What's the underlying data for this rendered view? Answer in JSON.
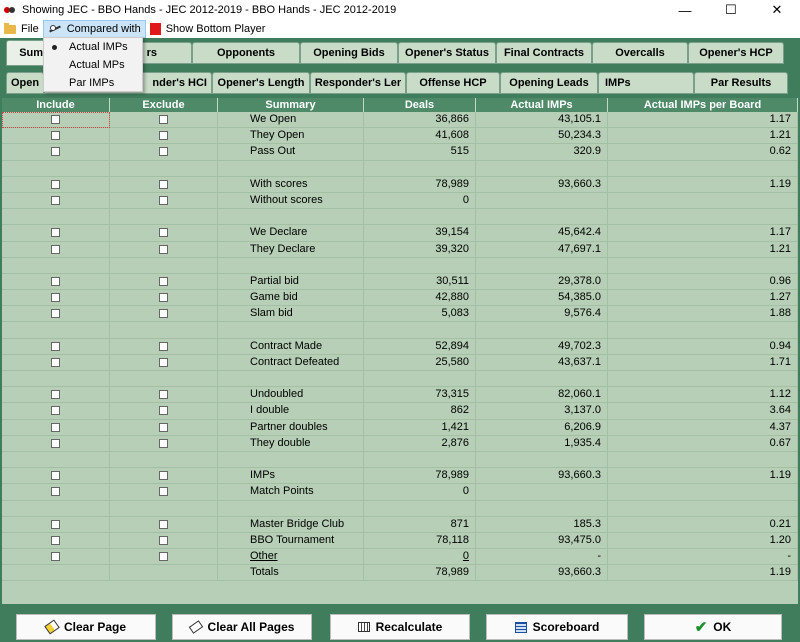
{
  "window": {
    "title": "Showing JEC  -  BBO Hands  - JEC 2012-2019  -  BBO Hands  - JEC 2012-2019",
    "minimize": "—",
    "maximize": "☐",
    "close": "✕"
  },
  "menu": {
    "file": "File",
    "compared_with": "Compared with",
    "show_bottom_player": "Show Bottom Player"
  },
  "dropdown": {
    "items": [
      "Actual IMPs",
      "Actual MPs",
      "Par IMPs"
    ],
    "selected": "Actual IMPs"
  },
  "tabs_row1": [
    "Summ",
    "rs",
    "Opponents",
    "Opening Bids",
    "Opener's Status",
    "Final Contracts",
    "Overcalls",
    "Opener's HCP"
  ],
  "tabs_row2": [
    "Open",
    "nder's HCI",
    "Opener's Length",
    "Responder's Ler",
    "Offense HCP",
    "Opening Leads",
    "IMPs",
    "Par Results"
  ],
  "table": {
    "headers": [
      "Include",
      "Exclude",
      "Summary",
      "Deals",
      "Actual IMPs",
      "Actual IMPs per Board"
    ],
    "rows": [
      {
        "summary": "We Open",
        "deals": "36,866",
        "imps": "43,105.1",
        "per_board": "1.17",
        "checks": true
      },
      {
        "summary": "They Open",
        "deals": "41,608",
        "imps": "50,234.3",
        "per_board": "1.21",
        "checks": true
      },
      {
        "summary": "Pass Out",
        "deals": "515",
        "imps": "320.9",
        "per_board": "0.62",
        "checks": true
      },
      {
        "summary": "",
        "deals": "",
        "imps": "",
        "per_board": "",
        "checks": false
      },
      {
        "summary": "With scores",
        "deals": "78,989",
        "imps": "93,660.3",
        "per_board": "1.19",
        "checks": true
      },
      {
        "summary": "Without scores",
        "deals": "0",
        "imps": "",
        "per_board": "",
        "checks": true
      },
      {
        "summary": "",
        "deals": "",
        "imps": "",
        "per_board": "",
        "checks": false
      },
      {
        "summary": "We Declare",
        "deals": "39,154",
        "imps": "45,642.4",
        "per_board": "1.17",
        "checks": true
      },
      {
        "summary": "They Declare",
        "deals": "39,320",
        "imps": "47,697.1",
        "per_board": "1.21",
        "checks": true
      },
      {
        "summary": "",
        "deals": "",
        "imps": "",
        "per_board": "",
        "checks": false
      },
      {
        "summary": "Partial bid",
        "deals": "30,511",
        "imps": "29,378.0",
        "per_board": "0.96",
        "checks": true
      },
      {
        "summary": "Game bid",
        "deals": "42,880",
        "imps": "54,385.0",
        "per_board": "1.27",
        "checks": true
      },
      {
        "summary": "Slam bid",
        "deals": "5,083",
        "imps": "9,576.4",
        "per_board": "1.88",
        "checks": true
      },
      {
        "summary": "",
        "deals": "",
        "imps": "",
        "per_board": "",
        "checks": false
      },
      {
        "summary": "Contract Made",
        "deals": "52,894",
        "imps": "49,702.3",
        "per_board": "0.94",
        "checks": true
      },
      {
        "summary": "Contract Defeated",
        "deals": "25,580",
        "imps": "43,637.1",
        "per_board": "1.71",
        "checks": true
      },
      {
        "summary": "",
        "deals": "",
        "imps": "",
        "per_board": "",
        "checks": false
      },
      {
        "summary": "Undoubled",
        "deals": "73,315",
        "imps": "82,060.1",
        "per_board": "1.12",
        "checks": true
      },
      {
        "summary": "I double",
        "deals": "862",
        "imps": "3,137.0",
        "per_board": "3.64",
        "checks": true
      },
      {
        "summary": "Partner doubles",
        "deals": "1,421",
        "imps": "6,206.9",
        "per_board": "4.37",
        "checks": true
      },
      {
        "summary": "They double",
        "deals": "2,876",
        "imps": "1,935.4",
        "per_board": "0.67",
        "checks": true
      },
      {
        "summary": "",
        "deals": "",
        "imps": "",
        "per_board": "",
        "checks": false
      },
      {
        "summary": "IMPs",
        "deals": "78,989",
        "imps": "93,660.3",
        "per_board": "1.19",
        "checks": true
      },
      {
        "summary": "Match Points",
        "deals": "0",
        "imps": "",
        "per_board": "",
        "checks": true
      },
      {
        "summary": "",
        "deals": "",
        "imps": "",
        "per_board": "",
        "checks": false
      },
      {
        "summary": "Master Bridge Club",
        "deals": "871",
        "imps": "185.3",
        "per_board": "0.21",
        "checks": true
      },
      {
        "summary": "BBO Tournament",
        "deals": "78,118",
        "imps": "93,475.0",
        "per_board": "1.20",
        "checks": true
      },
      {
        "summary": "Other",
        "deals": "0",
        "imps": "-",
        "per_board": "-",
        "checks": true,
        "underline": true
      },
      {
        "summary": "Totals",
        "deals": "78,989",
        "imps": "93,660.3",
        "per_board": "1.19",
        "checks": false
      }
    ]
  },
  "buttons": {
    "clear_page": "Clear Page",
    "clear_all_pages": "Clear All Pages",
    "recalculate": "Recalculate",
    "scoreboard": "Scoreboard",
    "ok": "OK"
  },
  "icons": {
    "check": "✔"
  }
}
